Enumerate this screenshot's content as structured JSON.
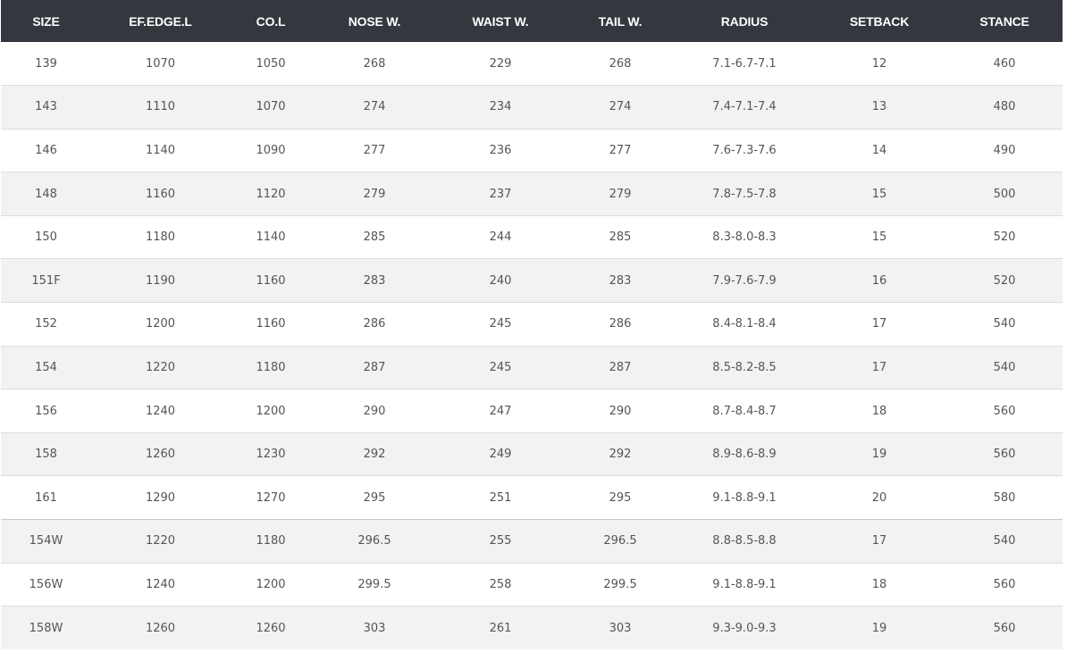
{
  "table": {
    "headers": [
      "SIZE",
      "EF.EDGE.L",
      "CO.L",
      "NOSE W.",
      "WAIST W.",
      "TAIL W.",
      "RADIUS",
      "SETBACK",
      "STANCE"
    ],
    "rows": [
      [
        "139",
        "1070",
        "1050",
        "268",
        "229",
        "268",
        "7.1-6.7-7.1",
        "12",
        "460"
      ],
      [
        "143",
        "1110",
        "1070",
        "274",
        "234",
        "274",
        "7.4-7.1-7.4",
        "13",
        "480"
      ],
      [
        "146",
        "1140",
        "1090",
        "277",
        "236",
        "277",
        "7.6-7.3-7.6",
        "14",
        "490"
      ],
      [
        "148",
        "1160",
        "1120",
        "279",
        "237",
        "279",
        "7.8-7.5-7.8",
        "15",
        "500"
      ],
      [
        "150",
        "1180",
        "1140",
        "285",
        "244",
        "285",
        "8.3-8.0-8.3",
        "15",
        "520"
      ],
      [
        "151F",
        "1190",
        "1160",
        "283",
        "240",
        "283",
        "7.9-7.6-7.9",
        "16",
        "520"
      ],
      [
        "152",
        "1200",
        "1160",
        "286",
        "245",
        "286",
        "8.4-8.1-8.4",
        "17",
        "540"
      ],
      [
        "154",
        "1220",
        "1180",
        "287",
        "245",
        "287",
        "8.5-8.2-8.5",
        "17",
        "540"
      ],
      [
        "156",
        "1240",
        "1200",
        "290",
        "247",
        "290",
        "8.7-8.4-8.7",
        "18",
        "560"
      ],
      [
        "158",
        "1260",
        "1230",
        "292",
        "249",
        "292",
        "8.9-8.6-8.9",
        "19",
        "560"
      ],
      [
        "161",
        "1290",
        "1270",
        "295",
        "251",
        "295",
        "9.1-8.8-9.1",
        "20",
        "580"
      ],
      [
        "154W",
        "1220",
        "1180",
        "296.5",
        "255",
        "296.5",
        "8.8-8.5-8.8",
        "17",
        "540"
      ],
      [
        "156W",
        "1240",
        "1200",
        "299.5",
        "258",
        "299.5",
        "9.1-8.8-9.1",
        "18",
        "560"
      ],
      [
        "158W",
        "1260",
        "1260",
        "303",
        "261",
        "303",
        "9.3-9.0-9.3",
        "19",
        "560"
      ]
    ]
  },
  "colors": {
    "header_bg": "#34373e",
    "header_text": "#ffffff",
    "row_alt_bg": "#f2f2f2",
    "cell_text": "#555555"
  }
}
